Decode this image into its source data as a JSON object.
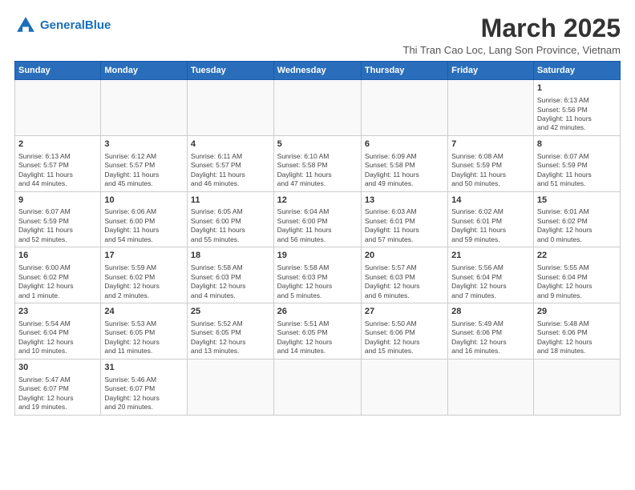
{
  "header": {
    "logo_general": "General",
    "logo_blue": "Blue",
    "month_year": "March 2025",
    "subtitle": "Thi Tran Cao Loc, Lang Son Province, Vietnam"
  },
  "weekdays": [
    "Sunday",
    "Monday",
    "Tuesday",
    "Wednesday",
    "Thursday",
    "Friday",
    "Saturday"
  ],
  "weeks": [
    [
      {
        "day": "",
        "info": ""
      },
      {
        "day": "",
        "info": ""
      },
      {
        "day": "",
        "info": ""
      },
      {
        "day": "",
        "info": ""
      },
      {
        "day": "",
        "info": ""
      },
      {
        "day": "",
        "info": ""
      },
      {
        "day": "1",
        "info": "Sunrise: 6:13 AM\nSunset: 5:56 PM\nDaylight: 11 hours\nand 42 minutes."
      }
    ],
    [
      {
        "day": "2",
        "info": "Sunrise: 6:13 AM\nSunset: 5:57 PM\nDaylight: 11 hours\nand 44 minutes."
      },
      {
        "day": "3",
        "info": "Sunrise: 6:12 AM\nSunset: 5:57 PM\nDaylight: 11 hours\nand 45 minutes."
      },
      {
        "day": "4",
        "info": "Sunrise: 6:11 AM\nSunset: 5:57 PM\nDaylight: 11 hours\nand 46 minutes."
      },
      {
        "day": "5",
        "info": "Sunrise: 6:10 AM\nSunset: 5:58 PM\nDaylight: 11 hours\nand 47 minutes."
      },
      {
        "day": "6",
        "info": "Sunrise: 6:09 AM\nSunset: 5:58 PM\nDaylight: 11 hours\nand 49 minutes."
      },
      {
        "day": "7",
        "info": "Sunrise: 6:08 AM\nSunset: 5:59 PM\nDaylight: 11 hours\nand 50 minutes."
      },
      {
        "day": "8",
        "info": "Sunrise: 6:07 AM\nSunset: 5:59 PM\nDaylight: 11 hours\nand 51 minutes."
      }
    ],
    [
      {
        "day": "9",
        "info": "Sunrise: 6:07 AM\nSunset: 5:59 PM\nDaylight: 11 hours\nand 52 minutes."
      },
      {
        "day": "10",
        "info": "Sunrise: 6:06 AM\nSunset: 6:00 PM\nDaylight: 11 hours\nand 54 minutes."
      },
      {
        "day": "11",
        "info": "Sunrise: 6:05 AM\nSunset: 6:00 PM\nDaylight: 11 hours\nand 55 minutes."
      },
      {
        "day": "12",
        "info": "Sunrise: 6:04 AM\nSunset: 6:00 PM\nDaylight: 11 hours\nand 56 minutes."
      },
      {
        "day": "13",
        "info": "Sunrise: 6:03 AM\nSunset: 6:01 PM\nDaylight: 11 hours\nand 57 minutes."
      },
      {
        "day": "14",
        "info": "Sunrise: 6:02 AM\nSunset: 6:01 PM\nDaylight: 11 hours\nand 59 minutes."
      },
      {
        "day": "15",
        "info": "Sunrise: 6:01 AM\nSunset: 6:02 PM\nDaylight: 12 hours\nand 0 minutes."
      }
    ],
    [
      {
        "day": "16",
        "info": "Sunrise: 6:00 AM\nSunset: 6:02 PM\nDaylight: 12 hours\nand 1 minute."
      },
      {
        "day": "17",
        "info": "Sunrise: 5:59 AM\nSunset: 6:02 PM\nDaylight: 12 hours\nand 2 minutes."
      },
      {
        "day": "18",
        "info": "Sunrise: 5:58 AM\nSunset: 6:03 PM\nDaylight: 12 hours\nand 4 minutes."
      },
      {
        "day": "19",
        "info": "Sunrise: 5:58 AM\nSunset: 6:03 PM\nDaylight: 12 hours\nand 5 minutes."
      },
      {
        "day": "20",
        "info": "Sunrise: 5:57 AM\nSunset: 6:03 PM\nDaylight: 12 hours\nand 6 minutes."
      },
      {
        "day": "21",
        "info": "Sunrise: 5:56 AM\nSunset: 6:04 PM\nDaylight: 12 hours\nand 7 minutes."
      },
      {
        "day": "22",
        "info": "Sunrise: 5:55 AM\nSunset: 6:04 PM\nDaylight: 12 hours\nand 9 minutes."
      }
    ],
    [
      {
        "day": "23",
        "info": "Sunrise: 5:54 AM\nSunset: 6:04 PM\nDaylight: 12 hours\nand 10 minutes."
      },
      {
        "day": "24",
        "info": "Sunrise: 5:53 AM\nSunset: 6:05 PM\nDaylight: 12 hours\nand 11 minutes."
      },
      {
        "day": "25",
        "info": "Sunrise: 5:52 AM\nSunset: 6:05 PM\nDaylight: 12 hours\nand 13 minutes."
      },
      {
        "day": "26",
        "info": "Sunrise: 5:51 AM\nSunset: 6:05 PM\nDaylight: 12 hours\nand 14 minutes."
      },
      {
        "day": "27",
        "info": "Sunrise: 5:50 AM\nSunset: 6:06 PM\nDaylight: 12 hours\nand 15 minutes."
      },
      {
        "day": "28",
        "info": "Sunrise: 5:49 AM\nSunset: 6:06 PM\nDaylight: 12 hours\nand 16 minutes."
      },
      {
        "day": "29",
        "info": "Sunrise: 5:48 AM\nSunset: 6:06 PM\nDaylight: 12 hours\nand 18 minutes."
      }
    ],
    [
      {
        "day": "30",
        "info": "Sunrise: 5:47 AM\nSunset: 6:07 PM\nDaylight: 12 hours\nand 19 minutes."
      },
      {
        "day": "31",
        "info": "Sunrise: 5:46 AM\nSunset: 6:07 PM\nDaylight: 12 hours\nand 20 minutes."
      },
      {
        "day": "",
        "info": ""
      },
      {
        "day": "",
        "info": ""
      },
      {
        "day": "",
        "info": ""
      },
      {
        "day": "",
        "info": ""
      },
      {
        "day": "",
        "info": ""
      }
    ]
  ]
}
